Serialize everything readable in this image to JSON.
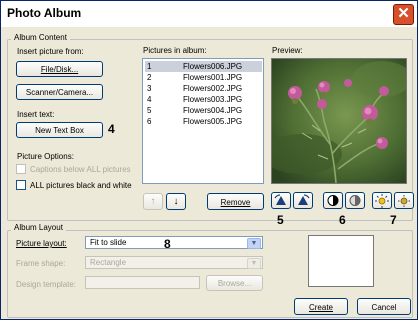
{
  "window": {
    "title": "Photo Album",
    "close_symbol": "✕"
  },
  "album_content": {
    "group_label": "Album Content",
    "insert_picture_label": "Insert picture from:",
    "file_disk_button": "File/Disk...",
    "scanner_camera_button": "Scanner/Camera...",
    "insert_text_label": "Insert text:",
    "new_text_box_button": "New Text Box",
    "picture_options_label": "Picture Options:",
    "captions_below_label": "Captions below ALL pictures",
    "black_white_label": "ALL pictures black and white",
    "pictures_in_album_label": "Pictures in album:",
    "pictures": [
      {
        "index": "1",
        "name": "Flowers006.JPG",
        "selected": true
      },
      {
        "index": "2",
        "name": "Flowers001.JPG",
        "selected": false
      },
      {
        "index": "3",
        "name": "Flowers002.JPG",
        "selected": false
      },
      {
        "index": "4",
        "name": "Flowers003.JPG",
        "selected": false
      },
      {
        "index": "5",
        "name": "Flowers004.JPG",
        "selected": false
      },
      {
        "index": "6",
        "name": "Flowers005.JPG",
        "selected": false
      }
    ],
    "move_up_symbol": "↑",
    "move_down_symbol": "↓",
    "remove_button": "Remove",
    "preview_label": "Preview:"
  },
  "callouts": {
    "c4": "4",
    "c5": "5",
    "c6": "6",
    "c7": "7",
    "c8": "8"
  },
  "album_layout": {
    "group_label": "Album Layout",
    "picture_layout_label": "Picture layout:",
    "picture_layout_value": "Fit to slide",
    "frame_shape_label": "Frame shape:",
    "frame_shape_value": "Rectangle",
    "design_template_label": "Design template:",
    "design_template_value": "",
    "browse_button": "Browse..."
  },
  "actions": {
    "create_button": "Create",
    "cancel_button": "Cancel"
  },
  "icons": [
    "close-icon",
    "move-up-icon",
    "move-down-icon",
    "rotate-left-icon",
    "rotate-right-icon",
    "contrast-more-icon",
    "contrast-less-icon",
    "brightness-more-icon",
    "brightness-less-icon",
    "dropdown-arrow-icon"
  ],
  "colors": {
    "title_close": "#d8502b",
    "dialog_bg": "#ece9d8",
    "list_selection": "#cbd0da",
    "button_border": "#003c74"
  }
}
